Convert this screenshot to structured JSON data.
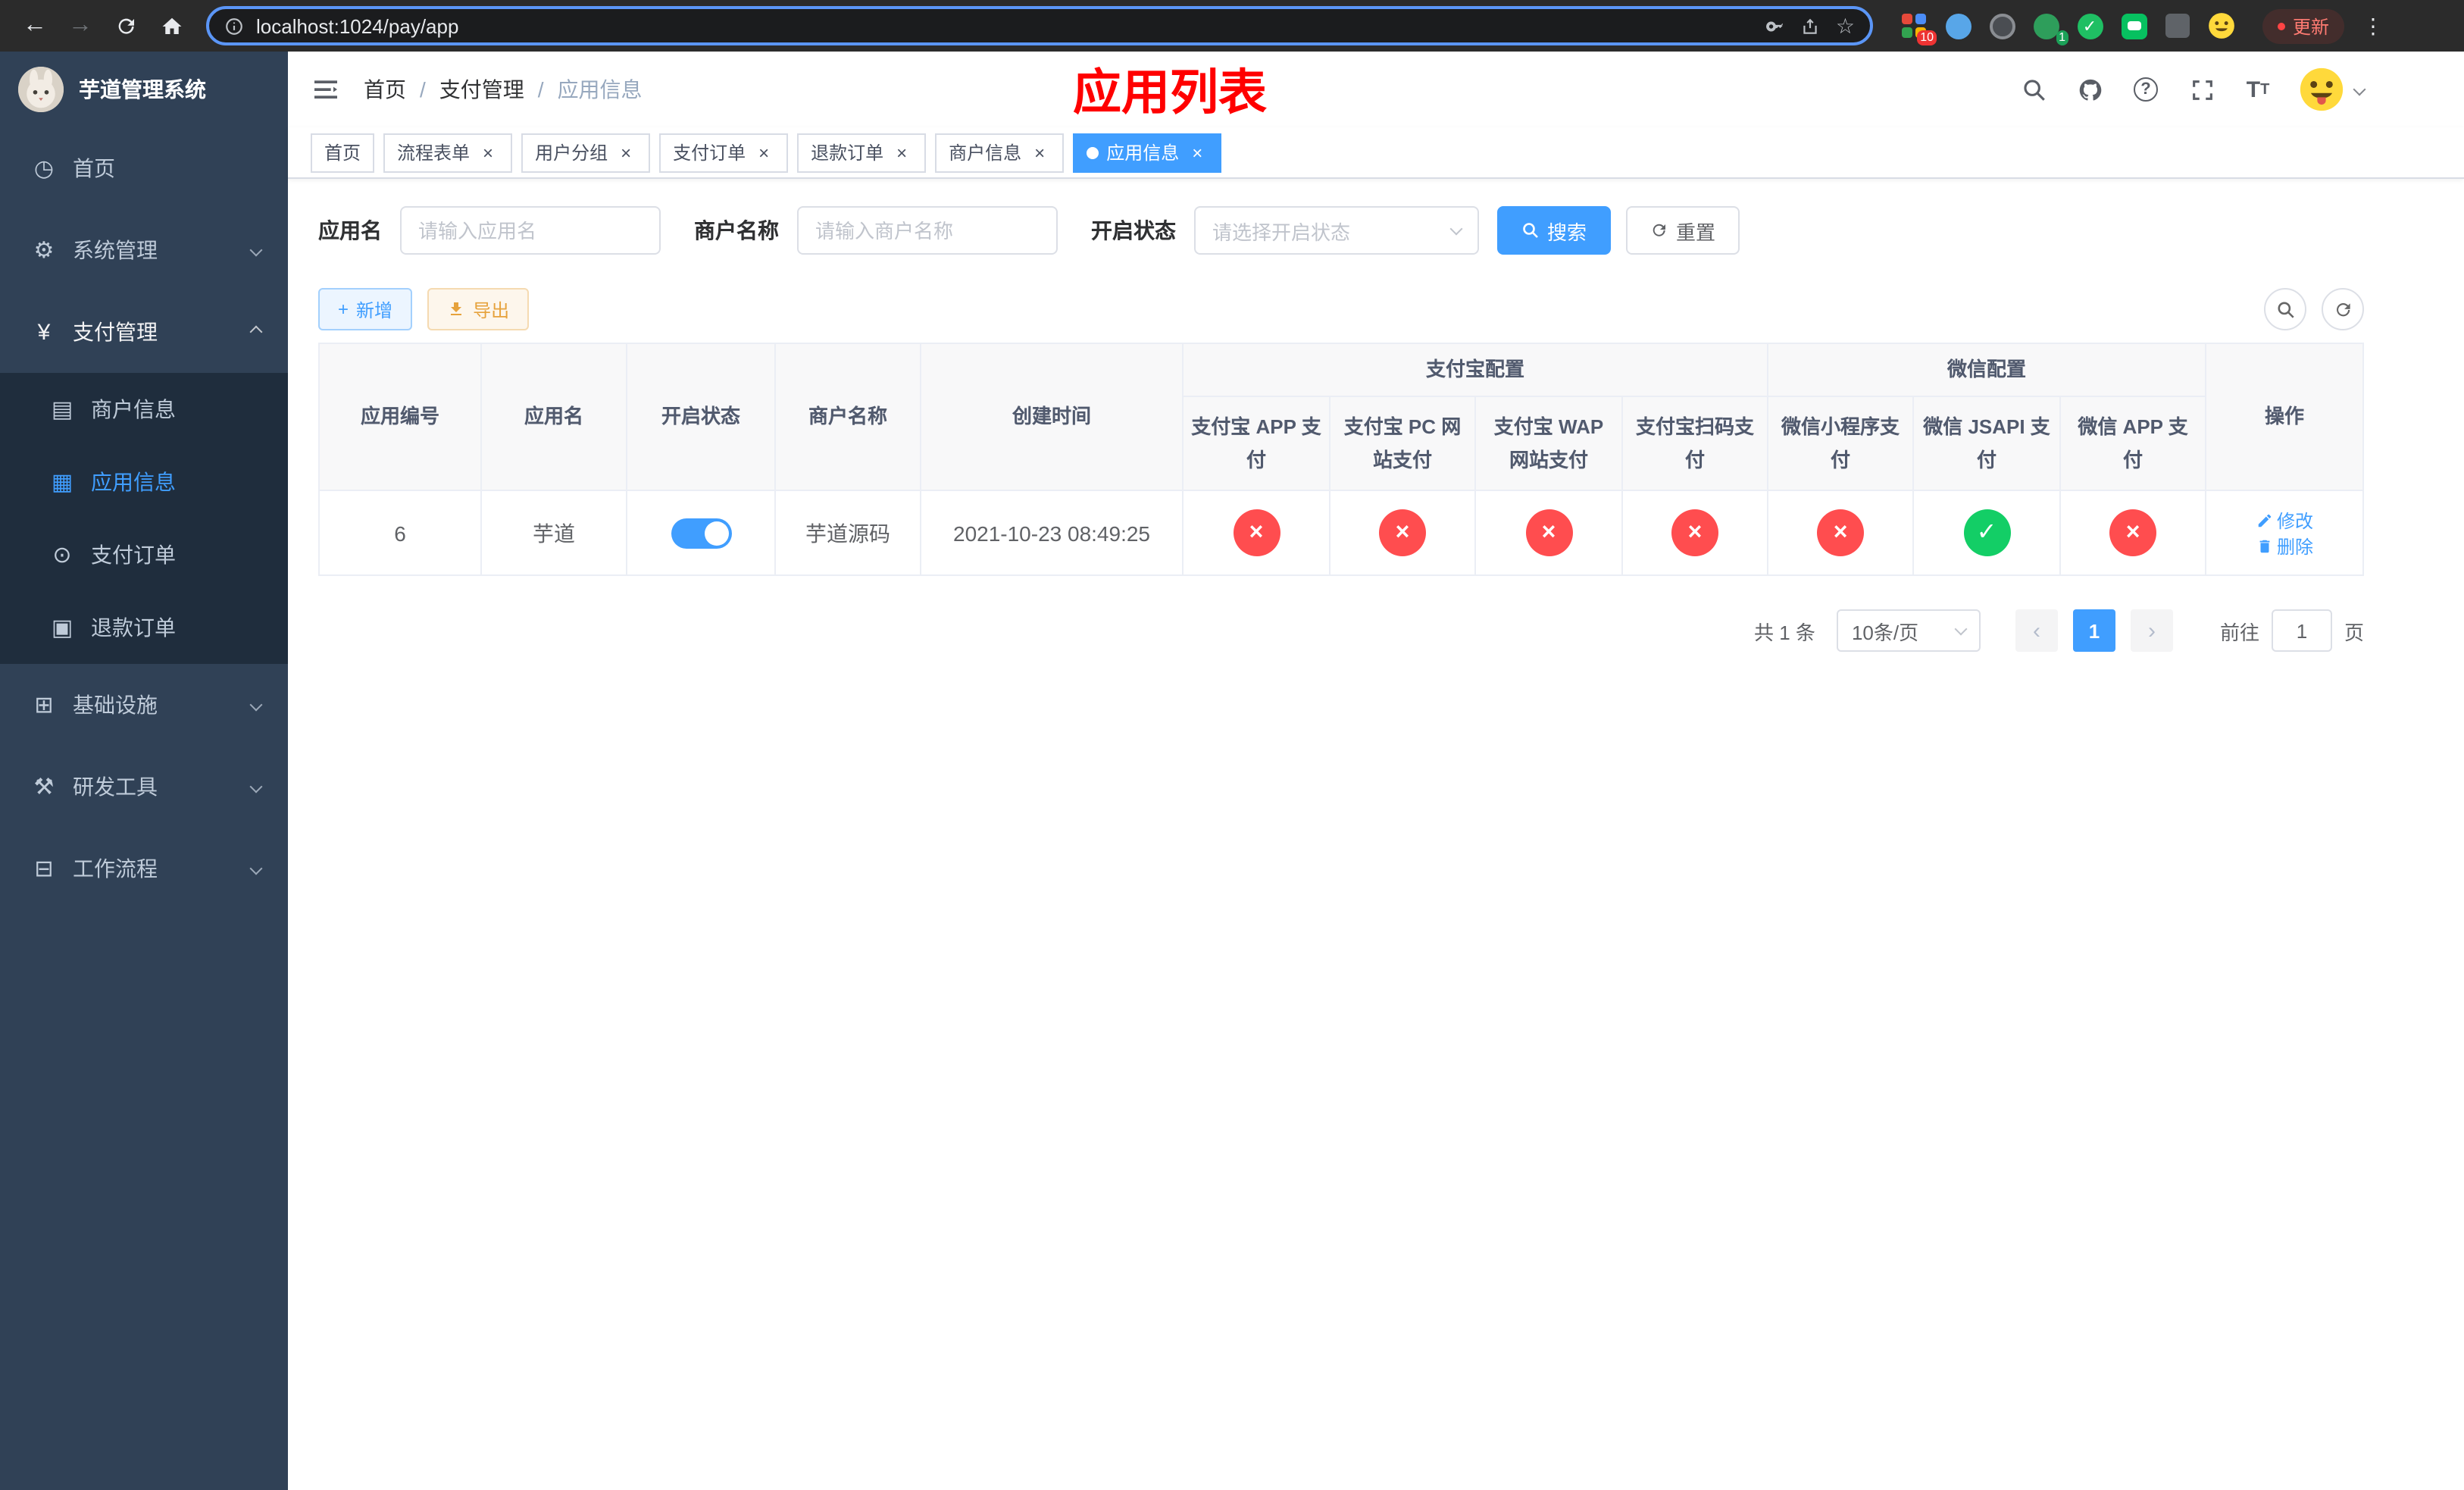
{
  "browser": {
    "url": "localhost:1024/pay/app",
    "update_label": "更新",
    "ext_badge": "10",
    "ext_badge_small": "1"
  },
  "sidebar": {
    "title": "芋道管理系统",
    "menu": [
      {
        "label": "首页"
      },
      {
        "label": "系统管理"
      },
      {
        "label": "支付管理"
      },
      {
        "label": "商户信息"
      },
      {
        "label": "应用信息"
      },
      {
        "label": "支付订单"
      },
      {
        "label": "退款订单"
      },
      {
        "label": "基础设施"
      },
      {
        "label": "研发工具"
      },
      {
        "label": "工作流程"
      }
    ]
  },
  "header": {
    "breadcrumb": [
      {
        "label": "首页"
      },
      {
        "label": "支付管理"
      },
      {
        "label": "应用信息"
      }
    ],
    "page_title": "应用列表"
  },
  "tabs": [
    {
      "label": "首页"
    },
    {
      "label": "流程表单"
    },
    {
      "label": "用户分组"
    },
    {
      "label": "支付订单"
    },
    {
      "label": "退款订单"
    },
    {
      "label": "商户信息"
    },
    {
      "label": "应用信息"
    }
  ],
  "filters": {
    "app_name": {
      "label": "应用名",
      "placeholder": "请输入应用名"
    },
    "merchant_name": {
      "label": "商户名称",
      "placeholder": "请输入商户名称"
    },
    "status": {
      "label": "开启状态",
      "placeholder": "请选择开启状态"
    },
    "search": "搜索",
    "reset": "重置"
  },
  "toolbar": {
    "add": "新增",
    "export": "导出"
  },
  "table": {
    "columns": {
      "id": "应用编号",
      "name": "应用名",
      "status": "开启状态",
      "merchant": "商户名称",
      "created": "创建时间",
      "alipay_group": "支付宝配置",
      "wechat_group": "微信配置",
      "alipay_app": "支付宝 APP 支付",
      "alipay_pc": "支付宝 PC 网站支付",
      "alipay_wap": "支付宝 WAP 网站支付",
      "alipay_scan": "支付宝扫码支付",
      "wechat_mini": "微信小程序支付",
      "wechat_jsapi": "微信 JSAPI 支付",
      "wechat_app": "微信 APP 支付",
      "ops": "操作"
    },
    "row": {
      "id": "6",
      "name": "芋道",
      "enabled": true,
      "merchant": "芋道源码",
      "created": "2021-10-23 08:49:25",
      "configs": [
        false,
        false,
        false,
        false,
        false,
        true,
        false
      ],
      "edit": "修改",
      "delete": "删除"
    }
  },
  "pagination": {
    "total": "共 1 条",
    "page_size": "10条/页",
    "page": "1",
    "goto_label": "前往",
    "goto_value": "1",
    "goto_suffix": "页"
  }
}
